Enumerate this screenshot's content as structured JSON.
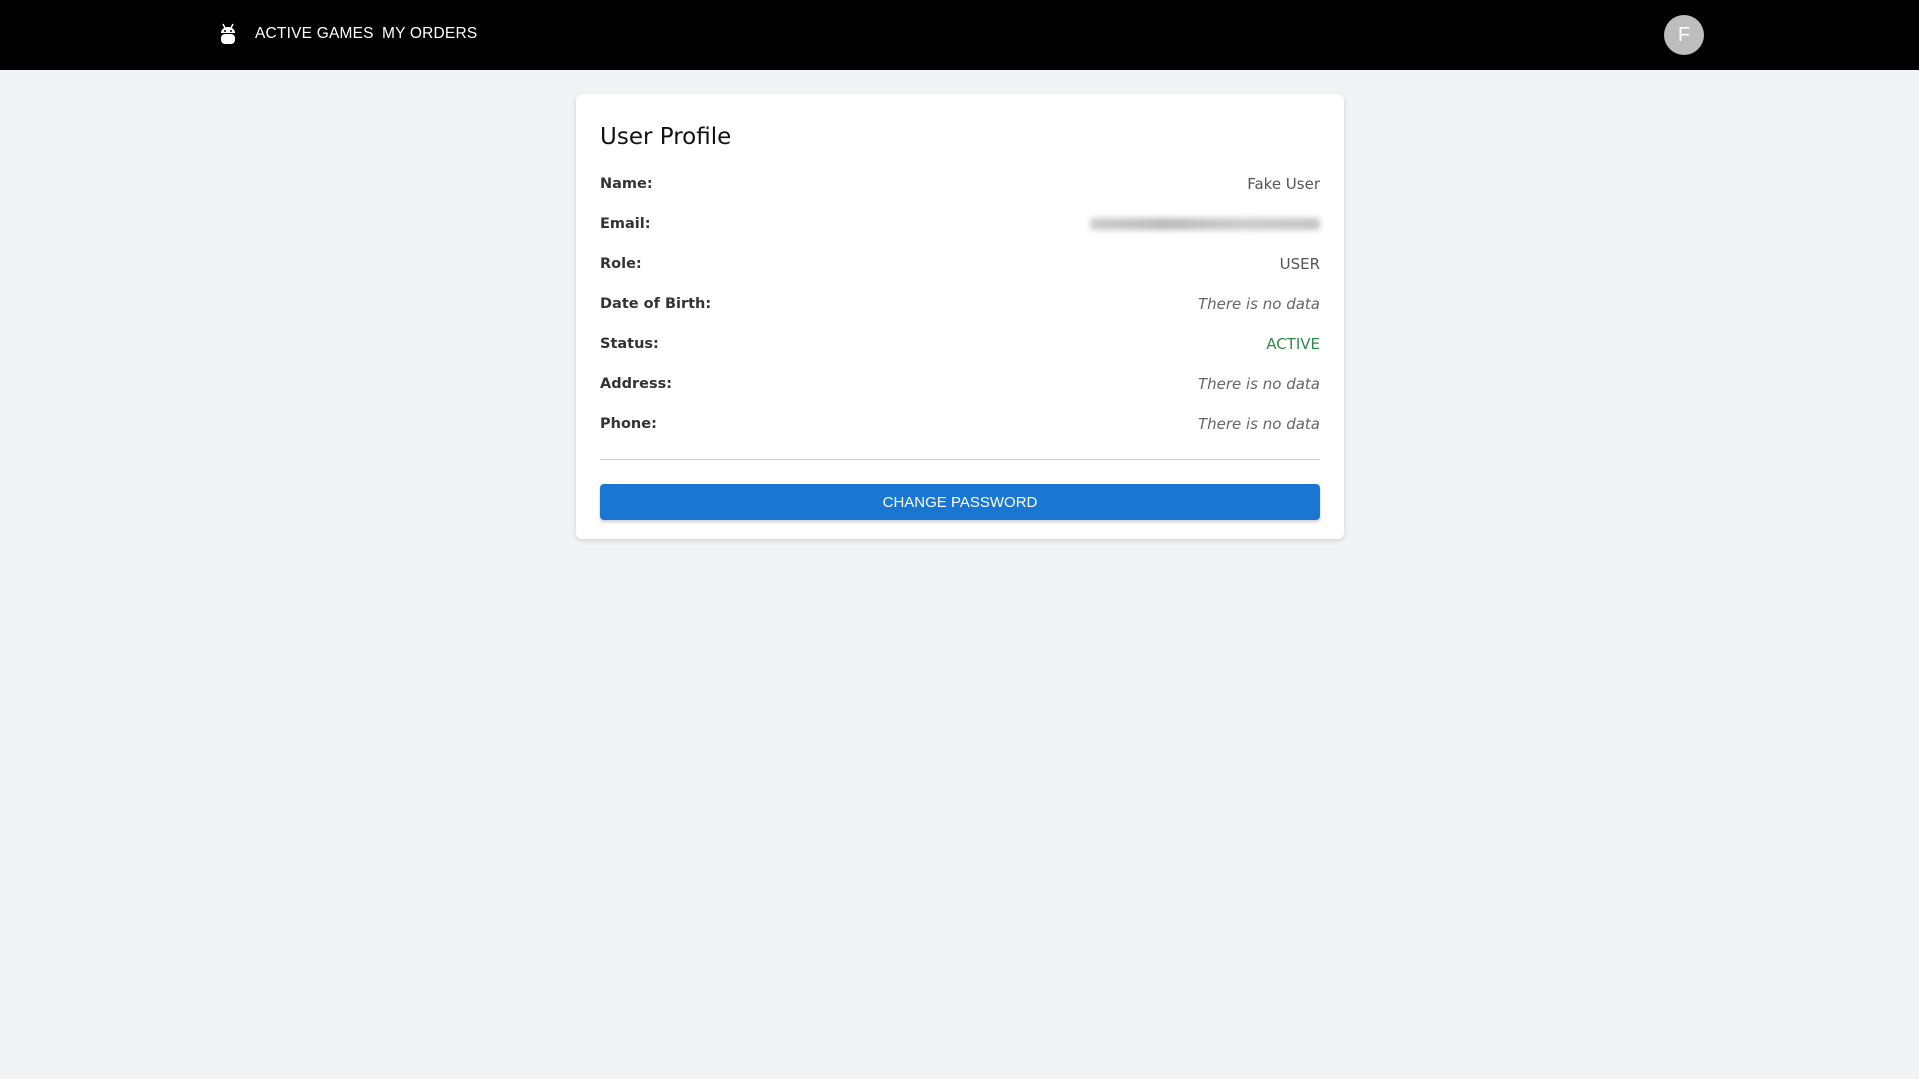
{
  "nav": {
    "links": [
      "ACTIVE GAMES",
      "MY ORDERS"
    ],
    "avatar_initial": "F"
  },
  "profile": {
    "title": "User Profile",
    "rows": [
      {
        "label": "Name:",
        "value": "Fake User"
      },
      {
        "label": "Email:",
        "value": null
      },
      {
        "label": "Role:",
        "value": "USER"
      },
      {
        "label": "Date of Birth:",
        "value": "There is no data"
      },
      {
        "label": "Status:",
        "value": "ACTIVE"
      },
      {
        "label": "Address:",
        "value": "There is no data"
      },
      {
        "label": "Phone:",
        "value": "There is no data"
      }
    ],
    "button_label": "CHANGE PASSWORD"
  },
  "colors": {
    "accent": "#1976d2",
    "status_active": "#2e8b4a",
    "nav_bg": "#000000"
  }
}
